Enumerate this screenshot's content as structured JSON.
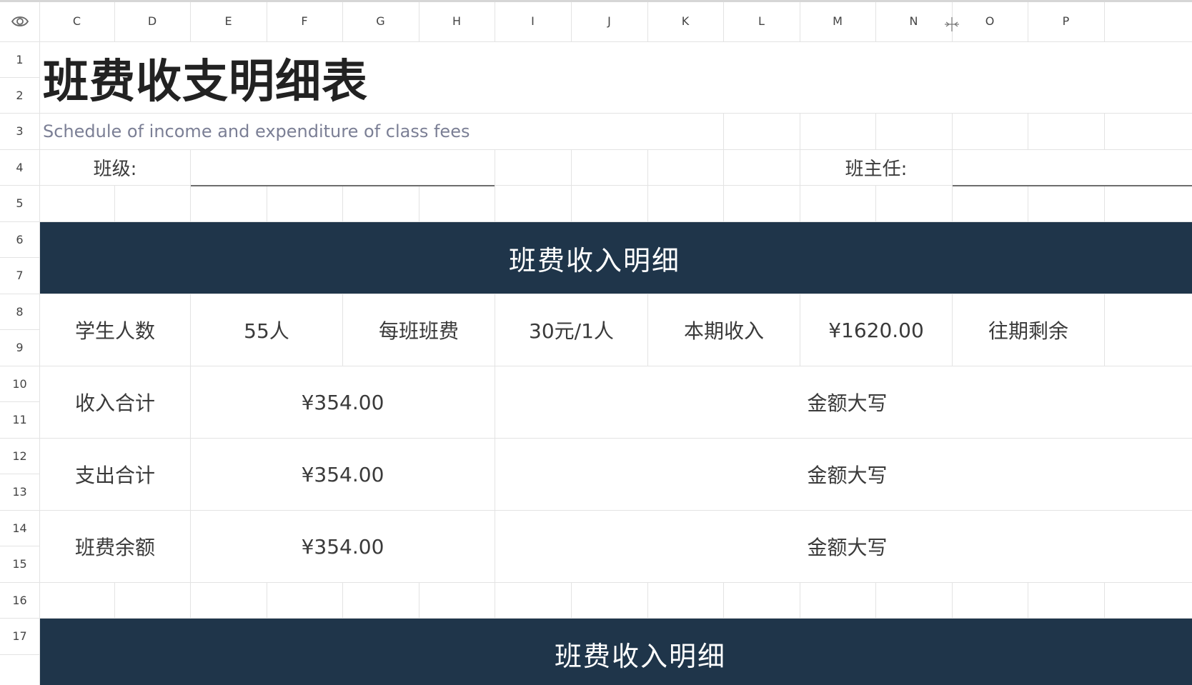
{
  "column_headers": [
    "C",
    "D",
    "E",
    "F",
    "G",
    "H",
    "I",
    "J",
    "K",
    "L",
    "M",
    "N",
    "O",
    "P"
  ],
  "row_headers": [
    "1",
    "2",
    "3",
    "4",
    "5",
    "6",
    "7",
    "8",
    "9",
    "10",
    "11",
    "12",
    "13",
    "14",
    "15",
    "16",
    "17"
  ],
  "title": "班费收支明细表",
  "subtitle": "Schedule of income and expenditure of class fees",
  "class_label": "班级:",
  "teacher_label": "班主任:",
  "income_section_title": "班费收入明细",
  "row8": {
    "students_label": "学生人数",
    "students_value": "55人",
    "fee_label": "每班班费",
    "fee_value": "30元/1人",
    "income_label": "本期收入",
    "income_value": "¥1620.00",
    "previous_label": "往期剩余"
  },
  "totals": [
    {
      "label": "收入合计",
      "amount": "¥354.00",
      "words_label": "金额大写"
    },
    {
      "label": "支出合计",
      "amount": "¥354.00",
      "words_label": "金额大写"
    },
    {
      "label": "班费余额",
      "amount": "¥354.00",
      "words_label": "金额大写"
    }
  ],
  "row17_title_partial": "班费收入明细",
  "colors": {
    "header_dark": "#1f354a",
    "grid_line": "#e3e3e3",
    "subtitle_color": "#7b7f95"
  }
}
